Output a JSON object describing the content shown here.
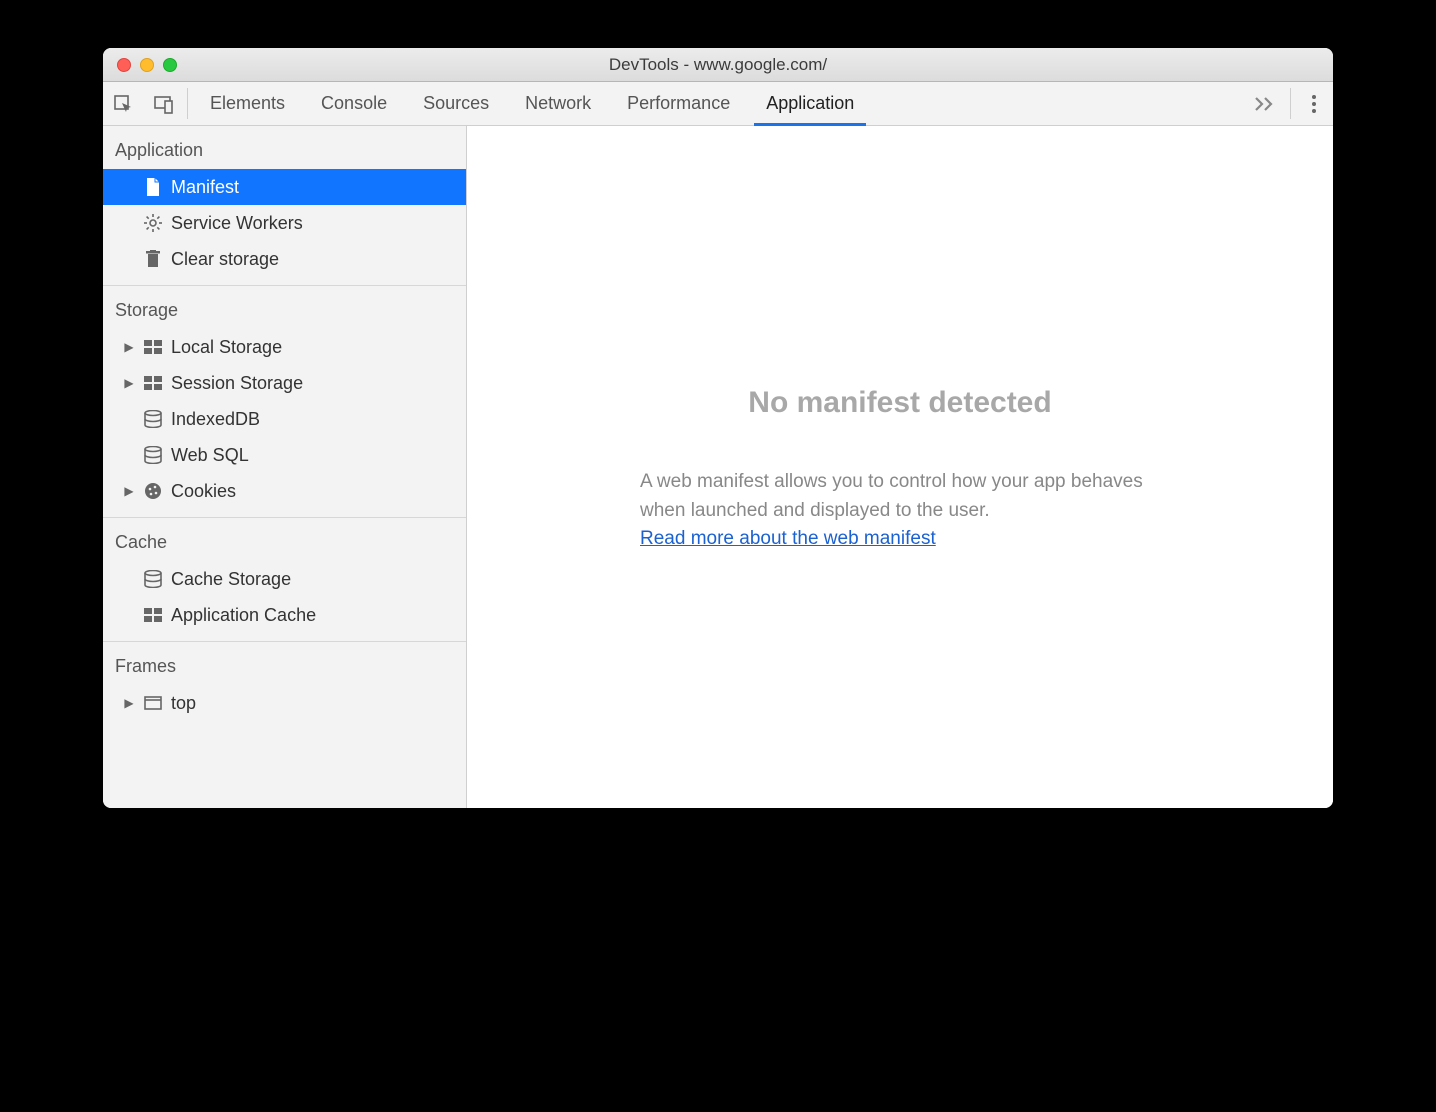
{
  "window_title": "DevTools - www.google.com/",
  "toolbar": {
    "tabs": [
      "Elements",
      "Console",
      "Sources",
      "Network",
      "Performance",
      "Application"
    ],
    "active_tab": "Application"
  },
  "sidebar": {
    "groups": [
      {
        "title": "Application",
        "items": [
          {
            "label": "Manifest",
            "icon": "file-icon",
            "selected": true,
            "expandable": false
          },
          {
            "label": "Service Workers",
            "icon": "gear-icon",
            "selected": false,
            "expandable": false
          },
          {
            "label": "Clear storage",
            "icon": "trash-icon",
            "selected": false,
            "expandable": false
          }
        ]
      },
      {
        "title": "Storage",
        "items": [
          {
            "label": "Local Storage",
            "icon": "table-icon",
            "selected": false,
            "expandable": true
          },
          {
            "label": "Session Storage",
            "icon": "table-icon",
            "selected": false,
            "expandable": true
          },
          {
            "label": "IndexedDB",
            "icon": "database-icon",
            "selected": false,
            "expandable": false
          },
          {
            "label": "Web SQL",
            "icon": "database-icon",
            "selected": false,
            "expandable": false
          },
          {
            "label": "Cookies",
            "icon": "cookie-icon",
            "selected": false,
            "expandable": true
          }
        ]
      },
      {
        "title": "Cache",
        "items": [
          {
            "label": "Cache Storage",
            "icon": "database-icon",
            "selected": false,
            "expandable": false
          },
          {
            "label": "Application Cache",
            "icon": "table-icon",
            "selected": false,
            "expandable": false
          }
        ]
      },
      {
        "title": "Frames",
        "items": [
          {
            "label": "top",
            "icon": "window-icon",
            "selected": false,
            "expandable": true
          }
        ]
      }
    ]
  },
  "main": {
    "heading": "No manifest detected",
    "description": "A web manifest allows you to control how your app behaves when launched and displayed to the user.",
    "link_text": "Read more about the web manifest"
  }
}
